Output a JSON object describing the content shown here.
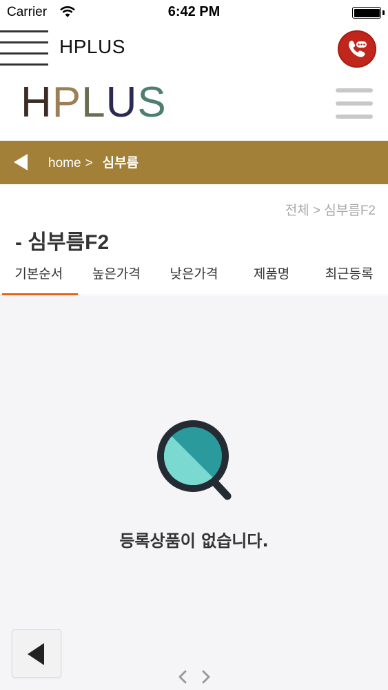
{
  "status_bar": {
    "carrier": "Carrier",
    "time": "6:42 PM",
    "icons": [
      "wifi-icon",
      "battery-icon"
    ]
  },
  "app_bar": {
    "title": "HPLUS",
    "icons": [
      "hamburger-icon",
      "phone-icon"
    ],
    "call_button_color": "#c0261b"
  },
  "header": {
    "logo_letters": [
      "H",
      "P",
      "L",
      "U",
      "S"
    ],
    "logo_colors": [
      "#3b2c25",
      "#9d7f55",
      "#6a6d52",
      "#2b2a55",
      "#4e7f6e"
    ],
    "menu_icon": "menu-icon"
  },
  "breadcrumb": {
    "background_color": "#a28037",
    "home": "home",
    "separator": ">",
    "current": "심부름"
  },
  "content": {
    "path": "전체 > 심부름F2",
    "heading": "- 심부름F2",
    "tabs": [
      {
        "label": "기본순서",
        "active": true
      },
      {
        "label": "높은가격",
        "active": false
      },
      {
        "label": "낮은가격",
        "active": false
      },
      {
        "label": "제품명",
        "active": false
      },
      {
        "label": "최근등록",
        "active": false
      }
    ],
    "active_tab_color": "#e8620f",
    "empty_message": "등록상품이 없습니다.",
    "empty_icon": "search-icon"
  },
  "footer": {
    "back_icon": "back-arrow-icon",
    "pager_icons": [
      "chevron-left-icon",
      "chevron-right-icon"
    ]
  }
}
